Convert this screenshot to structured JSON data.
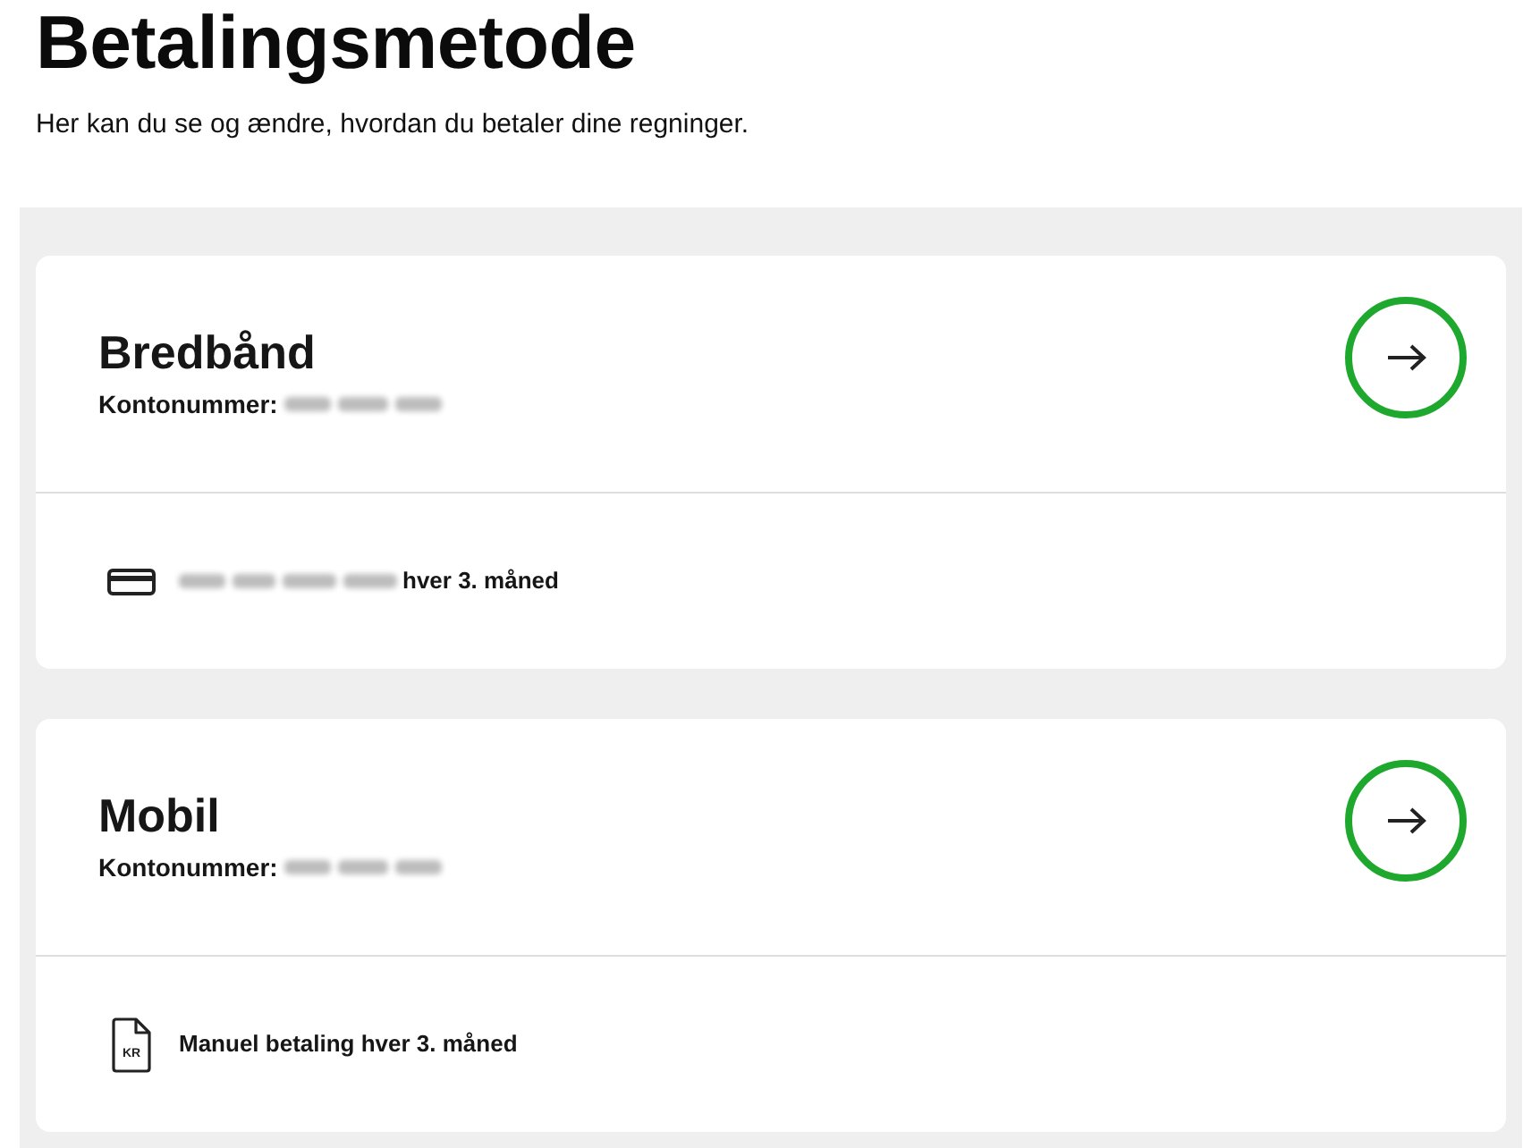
{
  "page": {
    "title": "Betalingsmetode",
    "subtitle": "Her kan du se og ændre, hvordan du betaler dine regninger."
  },
  "accounts": [
    {
      "name": "Bredbånd",
      "account_label": "Kontonummer:",
      "account_number_blurred": true,
      "payment": {
        "kind": "card",
        "number_blurred": true,
        "text": "hver 3. måned"
      }
    },
    {
      "name": "Mobil",
      "account_label": "Kontonummer:",
      "account_number_blurred": true,
      "payment": {
        "kind": "invoice",
        "icon_text": "KR",
        "number_blurred": false,
        "text": "Manuel betaling hver 3. måned"
      }
    }
  ]
}
